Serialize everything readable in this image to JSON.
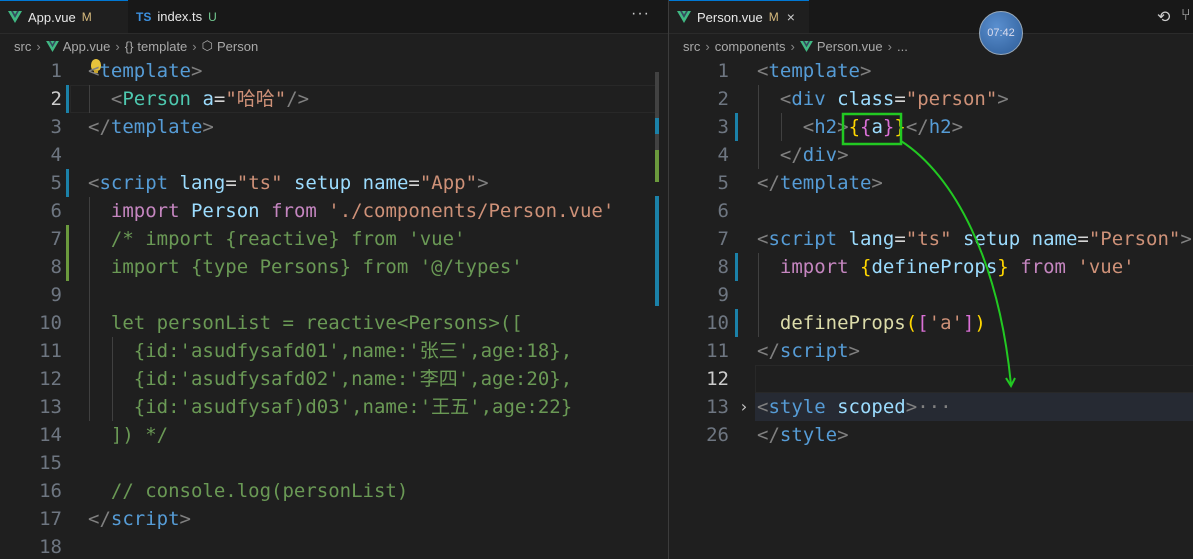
{
  "left": {
    "tabs": [
      {
        "icon": "vue-logo-icon",
        "name": "App.vue",
        "status": "M",
        "active": true
      },
      {
        "icon": "typescript-icon",
        "iconText": "TS",
        "name": "index.ts",
        "status": "U",
        "active": false
      }
    ],
    "more_label": "···",
    "breadcrumb": [
      "src",
      "App.vue",
      "{}",
      "template",
      "Person"
    ],
    "lines": [
      "1",
      "2",
      "3",
      "4",
      "5",
      "6",
      "7",
      "8",
      "9",
      "10",
      "11",
      "12",
      "13",
      "14",
      "15",
      "16",
      "17",
      "18"
    ]
  },
  "right": {
    "tab": {
      "icon": "vue-logo-icon",
      "name": "Person.vue",
      "status": "M",
      "close": "×"
    },
    "breadcrumb": [
      "src",
      "components",
      "Person.vue",
      "..."
    ],
    "lines": [
      "1",
      "2",
      "3",
      "4",
      "5",
      "6",
      "7",
      "8",
      "9",
      "10",
      "11",
      "12",
      "13",
      "26"
    ],
    "clock": "07:42"
  },
  "colors": {
    "background": "#1f1f1f",
    "tag": "#569cd6",
    "component": "#4ec9b0",
    "string": "#ce9178",
    "keyword": "#c586c0",
    "comment": "#6a9955",
    "annotation": "#22c922"
  }
}
